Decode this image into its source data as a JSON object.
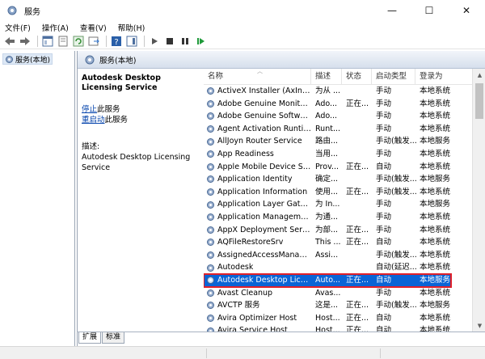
{
  "window": {
    "title": "服务",
    "min": "—",
    "max": "☐",
    "close": "✕"
  },
  "menu": [
    "文件(F)",
    "操作(A)",
    "查看(V)",
    "帮助(H)"
  ],
  "toolbar": {
    "icons": [
      "back-icon",
      "forward-icon",
      "show-tree-icon",
      "properties-icon",
      "refresh-icon",
      "export-icon",
      "help-icon",
      "console-icon",
      "start-service-icon",
      "stop-service-icon",
      "pause-service-icon",
      "restart-service-icon"
    ]
  },
  "tree": {
    "root_label": "服务(本地)"
  },
  "pane": {
    "header": "服务(本地)"
  },
  "details": {
    "title": "Autodesk Desktop Licensing Service",
    "stop_link": "停止",
    "stop_suffix": "此服务",
    "restart_link": "重启动",
    "restart_suffix": "此服务",
    "desc_label": "描述:",
    "desc_text": "Autodesk Desktop Licensing Service"
  },
  "columns": {
    "name": "名称",
    "desc": "描述",
    "status": "状态",
    "startup": "启动类型",
    "logon": "登录为"
  },
  "rows": [
    {
      "name": "ActiveX Installer (AxInstSV)",
      "desc": "为从 ...",
      "status": "",
      "startup": "手动",
      "logon": "本地系统"
    },
    {
      "name": "Adobe Genuine Monitor ...",
      "desc": "Ado...",
      "status": "正在...",
      "startup": "手动",
      "logon": "本地系统"
    },
    {
      "name": "Adobe Genuine Software...",
      "desc": "Ado...",
      "status": "",
      "startup": "手动",
      "logon": "本地系统"
    },
    {
      "name": "Agent Activation Runtime...",
      "desc": "Runt...",
      "status": "",
      "startup": "手动",
      "logon": "本地系统"
    },
    {
      "name": "AllJoyn Router Service",
      "desc": "路由...",
      "status": "",
      "startup": "手动(触发...",
      "logon": "本地服务"
    },
    {
      "name": "App Readiness",
      "desc": "当用...",
      "status": "",
      "startup": "手动",
      "logon": "本地系统"
    },
    {
      "name": "Apple Mobile Device Ser...",
      "desc": "Prov...",
      "status": "正在...",
      "startup": "自动",
      "logon": "本地系统"
    },
    {
      "name": "Application Identity",
      "desc": "确定...",
      "status": "",
      "startup": "手动(触发...",
      "logon": "本地服务"
    },
    {
      "name": "Application Information",
      "desc": "使用...",
      "status": "正在...",
      "startup": "手动(触发...",
      "logon": "本地系统"
    },
    {
      "name": "Application Layer Gatewa...",
      "desc": "为 In...",
      "status": "",
      "startup": "手动",
      "logon": "本地服务"
    },
    {
      "name": "Application Management",
      "desc": "为通...",
      "status": "",
      "startup": "手动",
      "logon": "本地系统"
    },
    {
      "name": "AppX Deployment Servic...",
      "desc": "为部...",
      "status": "正在...",
      "startup": "手动",
      "logon": "本地系统"
    },
    {
      "name": "AQFileRestoreSrv",
      "desc": "This ...",
      "status": "正在...",
      "startup": "自动",
      "logon": "本地系统"
    },
    {
      "name": "AssignedAccessManager...",
      "desc": "Assi...",
      "status": "",
      "startup": "手动(触发...",
      "logon": "本地系统"
    },
    {
      "name": "Autodesk",
      "desc": "",
      "status": "",
      "startup": "自动(延迟...",
      "logon": "本地系统"
    },
    {
      "name": "Autodesk Desktop Licens...",
      "desc": "Auto...",
      "status": "正在...",
      "startup": "自动",
      "logon": "本地服务",
      "selected": true
    },
    {
      "name": "Avast Cleanup",
      "desc": "Avas...",
      "status": "",
      "startup": "手动",
      "logon": "本地系统"
    },
    {
      "name": "AVCTP 服务",
      "desc": "这是...",
      "status": "正在...",
      "startup": "手动(触发...",
      "logon": "本地服务"
    },
    {
      "name": "Avira Optimizer Host",
      "desc": "Host...",
      "status": "正在...",
      "startup": "自动",
      "logon": "本地系统"
    },
    {
      "name": "Avira Service Host",
      "desc": "Host...",
      "status": "正在...",
      "startup": "自动",
      "logon": "本地系统"
    }
  ],
  "tabs": [
    "扩展",
    "标准"
  ],
  "colors": {
    "selection": "#0a64d6",
    "highlight_border": "#e0202a",
    "link": "#0645ad"
  }
}
